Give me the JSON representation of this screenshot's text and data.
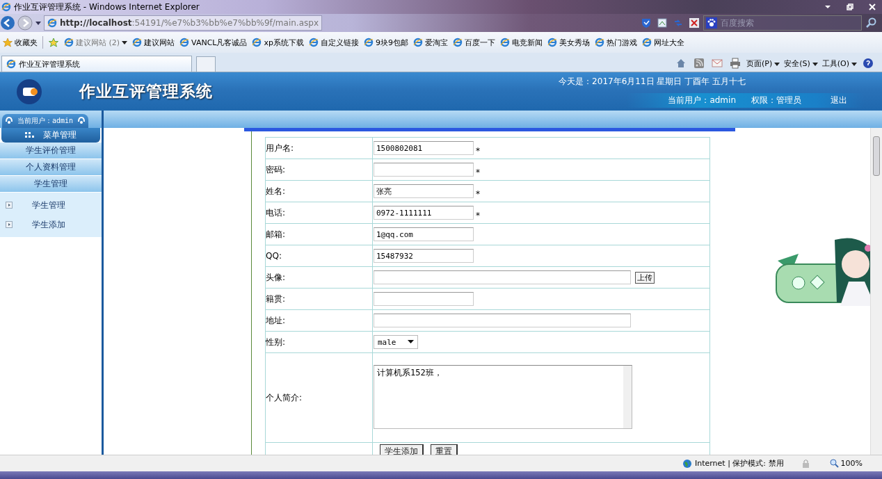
{
  "window": {
    "title": "作业互评管理系统 - Windows Internet Explorer"
  },
  "address": {
    "url_host": "http://localhost",
    "url_rest": ":54191/%e7%b3%bb%e7%bb%9f/main.aspx"
  },
  "search": {
    "placeholder": "百度搜索"
  },
  "favorites": {
    "label": "收藏夹",
    "items": [
      {
        "label": "建议网站 (2)",
        "dropdown": true
      },
      {
        "label": "建议网站",
        "dropdown": false
      },
      {
        "label": "VANCL凡客诚品",
        "dropdown": false
      },
      {
        "label": "xp系统下载",
        "dropdown": false
      },
      {
        "label": "自定义链接",
        "dropdown": false
      },
      {
        "label": "9块9包邮",
        "dropdown": false
      },
      {
        "label": "爱淘宝",
        "dropdown": false
      },
      {
        "label": "百度一下",
        "dropdown": false
      },
      {
        "label": "电竞新闻",
        "dropdown": false
      },
      {
        "label": "美女秀场",
        "dropdown": false
      },
      {
        "label": "热门游戏",
        "dropdown": false
      },
      {
        "label": "网址大全",
        "dropdown": false
      }
    ]
  },
  "tab": {
    "label": "作业互评管理系统"
  },
  "commands": [
    "页面(P)",
    "安全(S)",
    "工具(O)"
  ],
  "header": {
    "title": "作业互评管理系统",
    "date": "今天是：2017年6月11日  星期日  丁酉年  五月十七",
    "user": "当前用户：admin",
    "role": "权限：管理员",
    "logout": "退出"
  },
  "sidebar": {
    "user": "当前用户：admin",
    "menu_title": "菜单管理",
    "sections": [
      "学生评价管理",
      "个人资料管理",
      "学生管理"
    ],
    "items": [
      "学生管理",
      "学生添加"
    ]
  },
  "form": {
    "required_mark": "*",
    "rows": [
      {
        "kind": "text",
        "label": "用户名:",
        "value": "1500802081",
        "required": true,
        "wide": false
      },
      {
        "kind": "text",
        "label": "密码:",
        "required": true,
        "wide": false
      },
      {
        "kind": "text",
        "label": "姓名:",
        "value": "张亮",
        "required": true,
        "wide": false
      },
      {
        "kind": "text",
        "label": "电话:",
        "value": "0972-1111111",
        "required": true,
        "wide": false
      },
      {
        "kind": "text",
        "label": "邮箱:",
        "value": "1@qq.com",
        "required": false,
        "wide": false
      },
      {
        "kind": "text",
        "label": "QQ:",
        "value": "15487932",
        "required": false,
        "wide": false
      },
      {
        "kind": "file",
        "label": "头像:",
        "button": "上传",
        "wide": true
      },
      {
        "kind": "text",
        "label": "籍贯:",
        "required": false,
        "wide": false
      },
      {
        "kind": "text",
        "label": "地址:",
        "required": false,
        "wide": true
      },
      {
        "kind": "select",
        "label": "性别:",
        "value": "male"
      },
      {
        "kind": "textarea",
        "label": "个人简介:",
        "value": "计算机系152班，"
      },
      {
        "kind": "buttons",
        "buttons": [
          "学生添加",
          "重置"
        ]
      }
    ]
  },
  "status": {
    "zone": "Internet | 保护模式: 禁用",
    "zoom": "100%"
  }
}
